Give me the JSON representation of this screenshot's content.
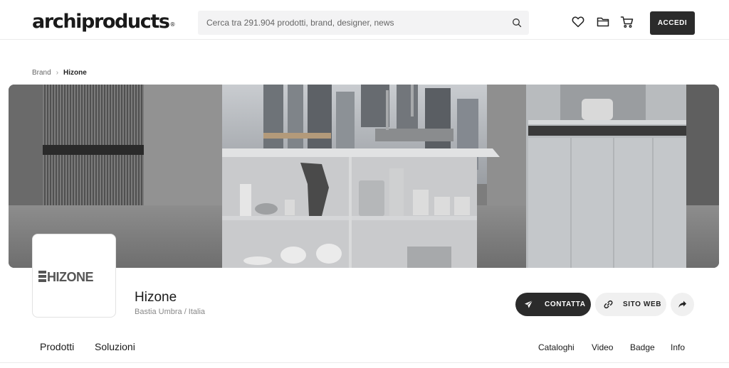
{
  "header": {
    "logo_text": "archiproducts",
    "logo_mark": "®",
    "search_placeholder": "Cerca tra 291.904 prodotti, brand, designer, news",
    "search_icon": "search-icon",
    "icons": [
      "heart-icon",
      "folder-icon",
      "cart-icon"
    ],
    "login_label": "ACCEDI"
  },
  "breadcrumb": {
    "items": [
      "Brand",
      "Hizone"
    ],
    "separator": "›"
  },
  "banner": {
    "image": "kitchen-interior-photo"
  },
  "brand": {
    "logo_text": "HIZONE",
    "name": "Hizone",
    "location": "Bastia Umbra / Italia"
  },
  "actions": {
    "contact_label": "CONTATTA",
    "website_label": "SITO WEB",
    "contact_icon": "send-icon",
    "website_icon": "link-icon",
    "share_icon": "share-icon"
  },
  "tabs": {
    "left": [
      "Prodotti",
      "Soluzioni"
    ],
    "right": [
      "Cataloghi",
      "Video",
      "Badge",
      "Info"
    ]
  },
  "colors": {
    "primary_dark": "#2b2b2b",
    "search_bg": "#f3f3f4",
    "secondary_btn_bg": "#f0f0f0"
  }
}
